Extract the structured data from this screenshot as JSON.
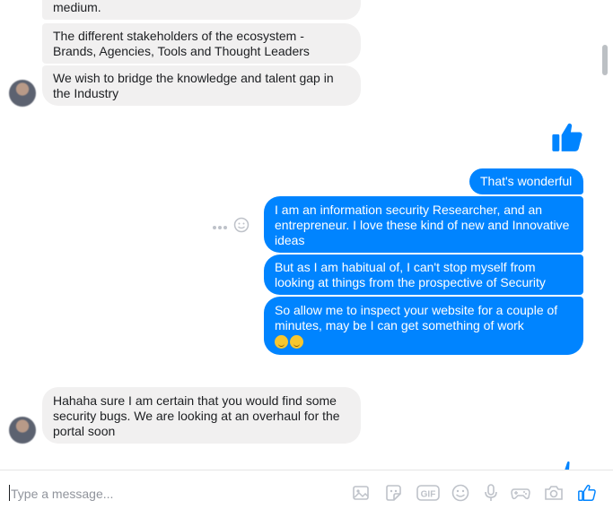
{
  "messages": {
    "incoming_top": [
      {
        "text": "medium."
      },
      {
        "text": "The different stakeholders of the ecosystem - Brands, Agencies, Tools and Thought Leaders"
      },
      {
        "text": "We wish to bridge the knowledge and talent gap in the Industry"
      }
    ],
    "outgoing": [
      {
        "text": "That's wonderful"
      },
      {
        "text": "I am an information security Researcher, and an entrepreneur. I love these kind of new and Innovative ideas"
      },
      {
        "text": "But as I am habitual of, I can't stop myself from looking at things from the prospective of Security"
      },
      {
        "text": "So allow me to inspect your website for a couple of minutes, may be I can get something of work"
      }
    ],
    "incoming_bottom": [
      {
        "text": "Hahaha sure I am certain that you would find some security bugs. We are looking at an overhaul for the portal soon"
      }
    ]
  },
  "composer": {
    "placeholder": "Type a message..."
  },
  "icons": {
    "like": "thumbs-up-icon",
    "more": "more-options-icon",
    "react": "smiley-react-icon",
    "tools": [
      "image-icon",
      "sticker-icon",
      "gif-icon",
      "emoji-icon",
      "microphone-icon",
      "game-icon",
      "camera-icon",
      "thumbs-up-icon"
    ]
  },
  "colors": {
    "accent": "#0084ff",
    "incoming_bubble": "#f1f0f0",
    "icon_gray": "#bec2c9"
  }
}
